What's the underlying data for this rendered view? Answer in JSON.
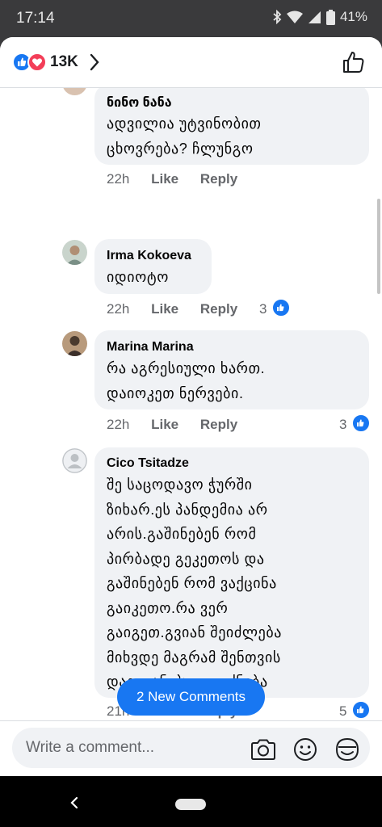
{
  "status_bar": {
    "time": "17:14",
    "battery": "41%"
  },
  "header": {
    "reaction_count": "13K"
  },
  "comments": [
    {
      "author": "ნინო ნანა",
      "text": "ადვილია უტვინობით\nცხოვრება? ჩლუნგო",
      "time": "22h",
      "like_label": "Like",
      "reply_label": "Reply",
      "reactions": ""
    },
    {
      "author": "Irma Kokoeva",
      "text": "იდიოტო",
      "time": "22h",
      "like_label": "Like",
      "reply_label": "Reply",
      "reactions": "3"
    },
    {
      "author": "Marina Marina",
      "text": "რა აგრესიული ხართ.\nდაიოკეთ ნერვები.",
      "time": "22h",
      "like_label": "Like",
      "reply_label": "Reply",
      "reactions": "3"
    },
    {
      "author": "Cico Tsitadze",
      "text": "შე საცოდავო ჭურში\nზიხარ.ეს პანდემია არ\nარის.გაშინებენ რომ\nპირბადე გეკეთოს და\nგაშინებენ რომ ვაქცინა\nგაიკეთო.რა ვერ\nგაიგეთ.გვიან შეიძლება\nმიხვდე მაგრამ შენთვის\nდაგვიანებული იქნება",
      "time": "21h",
      "like_label": "Like",
      "reply_label": "Reply",
      "reactions": "5"
    }
  ],
  "new_comments_label": "2 New Comments",
  "composer": {
    "placeholder": "Write a comment..."
  },
  "colors": {
    "accent": "#1877f2",
    "love": "#f33e58",
    "bubble": "#f0f2f5"
  },
  "icons": [
    "like-reaction-icon",
    "love-reaction-icon",
    "chevron-right-icon",
    "thumbs-up-icon",
    "camera-icon",
    "emoji-icon",
    "gif-sticker-icon",
    "back-icon"
  ]
}
